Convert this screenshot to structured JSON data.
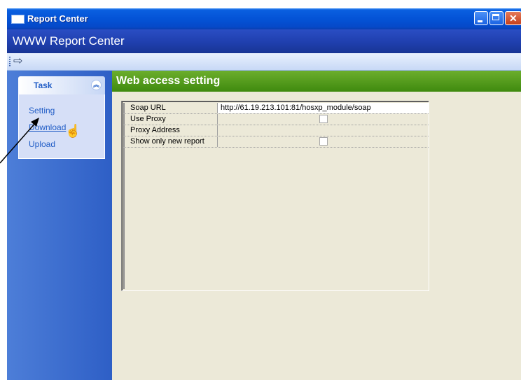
{
  "window": {
    "title": "Report Center"
  },
  "app": {
    "header_title": "WWW Report Center"
  },
  "toolbar": {
    "exit_icon": "exit-arrow-icon"
  },
  "taskpane": {
    "header": "Task",
    "items": [
      {
        "label": "Setting"
      },
      {
        "label": "Download"
      },
      {
        "label": "Upload"
      }
    ]
  },
  "section": {
    "title": "Web access setting"
  },
  "settings": {
    "rows": [
      {
        "name": "Soap URL",
        "value": "http://61.19.213.101:81/hosxp_module/soap",
        "type": "text"
      },
      {
        "name": "Use Proxy",
        "value": false,
        "type": "checkbox"
      },
      {
        "name": "Proxy Address",
        "value": "",
        "type": "text"
      },
      {
        "name": "Show only new report",
        "value": false,
        "type": "checkbox"
      }
    ]
  },
  "colors": {
    "title_bar": "#0453d6",
    "app_header": "#1f3fae",
    "task_pane": "#3e6fd0",
    "section_header": "#52a01c",
    "content_bg": "#ece9d8"
  }
}
